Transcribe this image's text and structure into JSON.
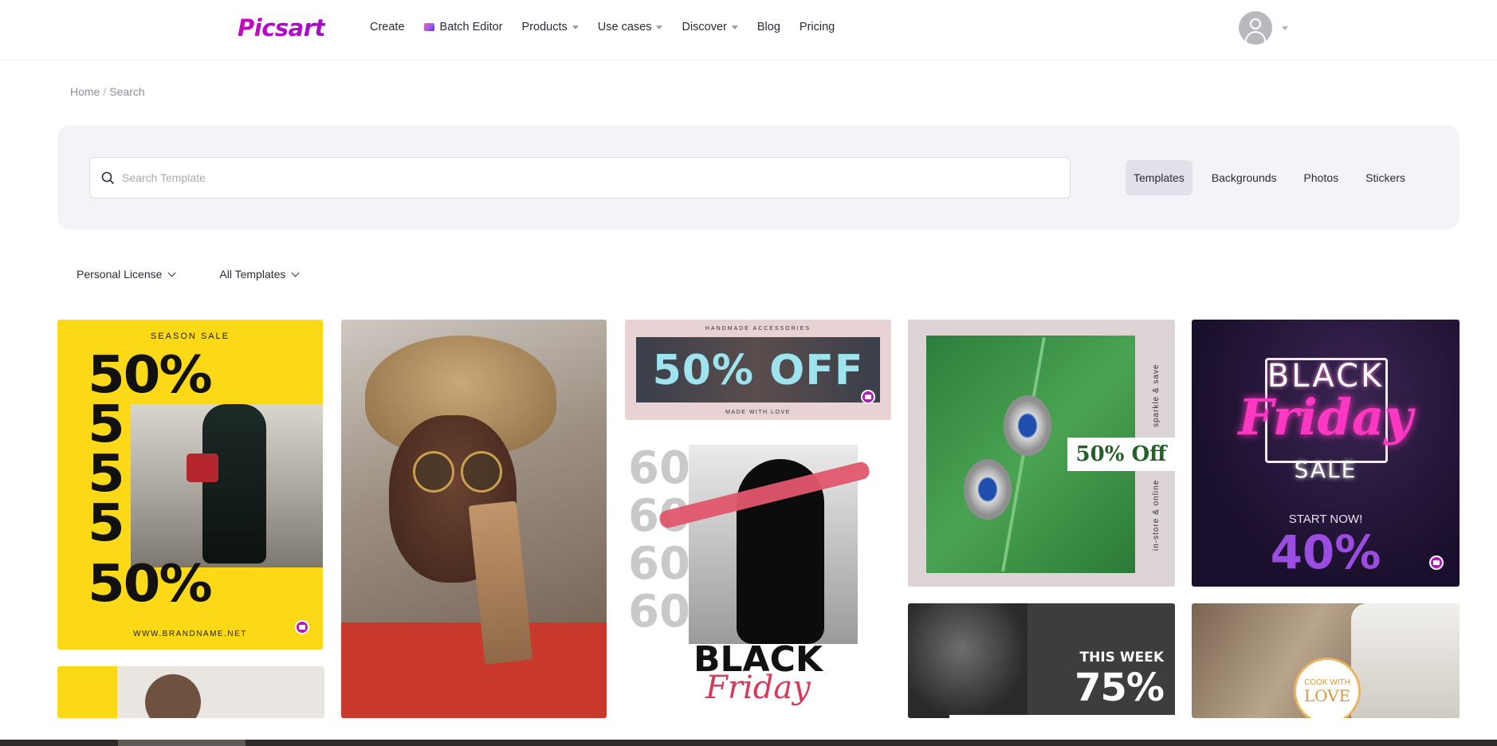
{
  "header": {
    "logo": "Picsart",
    "nav": [
      {
        "label": "Create",
        "dropdown": false
      },
      {
        "label": "Batch Editor",
        "dropdown": false,
        "icon": "batch-editor-icon"
      },
      {
        "label": "Products",
        "dropdown": true
      },
      {
        "label": "Use cases",
        "dropdown": true
      },
      {
        "label": "Discover",
        "dropdown": true
      },
      {
        "label": "Blog",
        "dropdown": false
      },
      {
        "label": "Pricing",
        "dropdown": false
      }
    ]
  },
  "breadcrumb": {
    "home": "Home",
    "separator": "/",
    "current": "Search"
  },
  "search": {
    "placeholder": "Search Template",
    "value": ""
  },
  "tabs": [
    {
      "label": "Templates",
      "active": true
    },
    {
      "label": "Backgrounds",
      "active": false
    },
    {
      "label": "Photos",
      "active": false
    },
    {
      "label": "Stickers",
      "active": false
    }
  ],
  "filters": {
    "license": "Personal License",
    "category": "All Templates"
  },
  "templates": {
    "season_sale": {
      "eyebrow": "SEASON SALE",
      "lines": [
        "50%",
        "5",
        "5",
        "5",
        "50%"
      ],
      "url": "WWW.BRANDNAME.NET"
    },
    "handmade": {
      "eyebrow": "HANDMADE ACCESSORIES",
      "headline": "50% OFF",
      "footer": "MADE WITH LOVE"
    },
    "black_friday_60": {
      "numbers": [
        "60%",
        "60%",
        "60%",
        "60%"
      ],
      "title": "BLACK",
      "script": "Friday"
    },
    "earrings": {
      "tag": "50% Off",
      "side_top": "sparkle & save",
      "side_bottom": "in-store & online"
    },
    "neon": {
      "line1": "BLACK",
      "line2": "Friday",
      "line3": "SALE",
      "cta": "START NOW!",
      "percent": "40%"
    },
    "this_week": {
      "line1": "THIS WEEK",
      "percent": "75%"
    },
    "cook": {
      "line1": "COOK WITH",
      "line2": "LOVE"
    }
  },
  "colors": {
    "brand": "#c209c1",
    "panel": "#f3f3f8",
    "active_tab": "#e1e1ea"
  }
}
